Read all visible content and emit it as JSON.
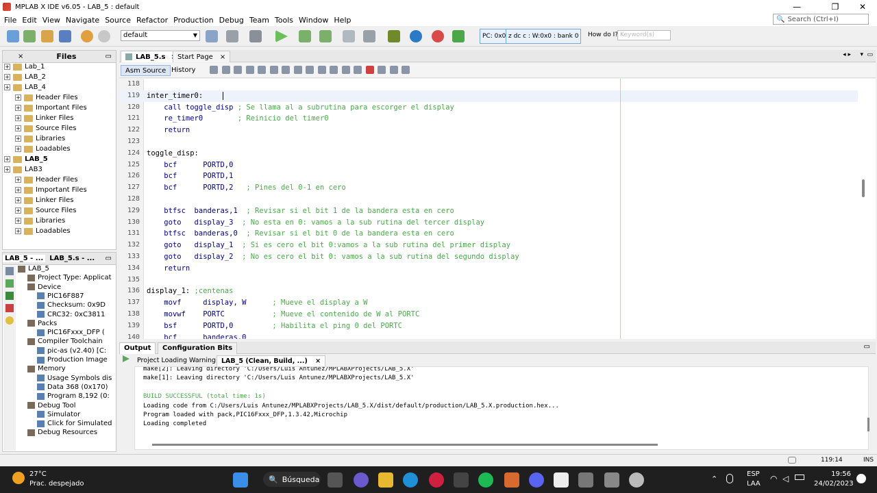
{
  "window": {
    "title": "MPLAB X IDE v6.05 - LAB_5 : default",
    "min": "—",
    "max": "❐",
    "close": "✕"
  },
  "menu": [
    "File",
    "Edit",
    "View",
    "Navigate",
    "Source",
    "Refactor",
    "Production",
    "Debug",
    "Team",
    "Tools",
    "Window",
    "Help"
  ],
  "search": {
    "placeholder": "Search (Ctrl+I)"
  },
  "toolbar": {
    "config": "default",
    "pc": "PC: 0x0",
    "status": "z dc c  : W:0x0 : bank 0",
    "howdo": "How do I?",
    "keyword_placeholder": "Keyword(s)"
  },
  "files_panel": {
    "tab": "Files",
    "items": [
      {
        "label": "Lab_1",
        "level": 0,
        "bold": false
      },
      {
        "label": "LAB_2",
        "level": 0,
        "bold": false
      },
      {
        "label": "LAB_4",
        "level": 0,
        "bold": false
      },
      {
        "label": "Header Files",
        "level": 1,
        "bold": false
      },
      {
        "label": "Important Files",
        "level": 1,
        "bold": false
      },
      {
        "label": "Linker Files",
        "level": 1,
        "bold": false
      },
      {
        "label": "Source Files",
        "level": 1,
        "bold": false
      },
      {
        "label": "Libraries",
        "level": 1,
        "bold": false
      },
      {
        "label": "Loadables",
        "level": 1,
        "bold": false
      },
      {
        "label": "LAB_5",
        "level": 0,
        "bold": true
      },
      {
        "label": "LAB3",
        "level": 0,
        "bold": false
      },
      {
        "label": "Header Files",
        "level": 1,
        "bold": false
      },
      {
        "label": "Important Files",
        "level": 1,
        "bold": false
      },
      {
        "label": "Linker Files",
        "level": 1,
        "bold": false
      },
      {
        "label": "Source Files",
        "level": 1,
        "bold": false
      },
      {
        "label": "Libraries",
        "level": 1,
        "bold": false
      },
      {
        "label": "Loadables",
        "level": 1,
        "bold": false
      }
    ]
  },
  "dashboard": {
    "tabs": [
      "LAB_5 - ...",
      "LAB_5.s - ..."
    ],
    "items": [
      {
        "label": "LAB_5",
        "level": 0
      },
      {
        "label": "Project Type: Applicat",
        "level": 1
      },
      {
        "label": "Device",
        "level": 1
      },
      {
        "label": "PIC16F887",
        "level": 2
      },
      {
        "label": "Checksum: 0x9D",
        "level": 2
      },
      {
        "label": "CRC32: 0xC3811",
        "level": 2
      },
      {
        "label": "Packs",
        "level": 1
      },
      {
        "label": "PIC16Fxxx_DFP (",
        "level": 2
      },
      {
        "label": "Compiler Toolchain",
        "level": 1
      },
      {
        "label": "pic-as (v2.40) [C:",
        "level": 2
      },
      {
        "label": "Production Image",
        "level": 2
      },
      {
        "label": "Memory",
        "level": 1
      },
      {
        "label": "Usage Symbols dis",
        "level": 2
      },
      {
        "label": "Data 368 (0x170)",
        "level": 2
      },
      {
        "label": "Program 8,192 (0:",
        "level": 2
      },
      {
        "label": "Debug Tool",
        "level": 1
      },
      {
        "label": "Simulator",
        "level": 2
      },
      {
        "label": "Click for Simulated",
        "level": 2
      },
      {
        "label": "Debug Resources",
        "level": 1
      }
    ]
  },
  "editor": {
    "tabs": [
      "LAB_5.s",
      "Start Page"
    ],
    "subtabs": [
      "Asm Source",
      "History"
    ],
    "lines": [
      {
        "n": "118",
        "label": "",
        "ins": "",
        "arg": "",
        "cmt": ""
      },
      {
        "n": "119",
        "label": "inter_timer0:",
        "ins": "",
        "arg": "",
        "cmt": ""
      },
      {
        "n": "120",
        "label": "",
        "ins": "call",
        "arg": " toggle_disp",
        "cmt": " ; Se llama al a subrutina para escorger el display"
      },
      {
        "n": "121",
        "label": "",
        "ins": "re_timer0",
        "arg": "",
        "cmt": "        ; Reinicio del timer0"
      },
      {
        "n": "122",
        "label": "",
        "ins": "return",
        "arg": "",
        "cmt": ""
      },
      {
        "n": "123",
        "label": "",
        "ins": "",
        "arg": "",
        "cmt": ""
      },
      {
        "n": "124",
        "label": "toggle_disp:",
        "ins": "",
        "arg": "",
        "cmt": ""
      },
      {
        "n": "125",
        "label": "",
        "ins": "bcf",
        "arg": "      PORTD,0",
        "cmt": ""
      },
      {
        "n": "126",
        "label": "",
        "ins": "bcf",
        "arg": "      PORTD,1",
        "cmt": ""
      },
      {
        "n": "127",
        "label": "",
        "ins": "bcf",
        "arg": "      PORTD,2",
        "cmt": "   ; Pines del 0-1 en cero"
      },
      {
        "n": "128",
        "label": "",
        "ins": "",
        "arg": "",
        "cmt": ""
      },
      {
        "n": "129",
        "label": "",
        "ins": "btfsc",
        "arg": "  banderas,1",
        "cmt": "  ; Revisar si el bit 1 de la bandera esta en cero"
      },
      {
        "n": "130",
        "label": "",
        "ins": "goto",
        "arg": "   display_3",
        "cmt": "  ; No esta en 0: vamos a la sub rutina del tercer display"
      },
      {
        "n": "131",
        "label": "",
        "ins": "btfsc",
        "arg": "  banderas,0",
        "cmt": "  ; Revisar si el bit 0 de la bandera esta en cero"
      },
      {
        "n": "132",
        "label": "",
        "ins": "goto",
        "arg": "   display_1",
        "cmt": "  ; Si es cero el bit 0:vamos a la sub rutina del primer display"
      },
      {
        "n": "133",
        "label": "",
        "ins": "goto",
        "arg": "   display_2",
        "cmt": "  ; No es cero el bit 0: vamos a la sub rutina del segundo display"
      },
      {
        "n": "134",
        "label": "",
        "ins": "return",
        "arg": "",
        "cmt": ""
      },
      {
        "n": "135",
        "label": "",
        "ins": "",
        "arg": "",
        "cmt": ""
      },
      {
        "n": "136",
        "label": "display_1:",
        "ins": "",
        "arg": "",
        "cmt": " ;centenas"
      },
      {
        "n": "137",
        "label": "",
        "ins": "movf",
        "arg": "     display, W",
        "cmt": "      ; Mueve el display a W"
      },
      {
        "n": "138",
        "label": "",
        "ins": "movwf",
        "arg": "    PORTC",
        "cmt": "           ; Mueve el contenido de W al PORTC"
      },
      {
        "n": "139",
        "label": "",
        "ins": "bsf",
        "arg": "      PORTD,0",
        "cmt": "         ; Habilita el ping 0 del PORTC"
      },
      {
        "n": "140",
        "label": "",
        "ins": "bcf",
        "arg": "      banderas,0",
        "cmt": ""
      }
    ]
  },
  "output": {
    "tabs": [
      "Output",
      "Configuration Bits"
    ],
    "subtabs": [
      "Project Loading Warning",
      "LAB_5 (Clean, Build, ...)"
    ],
    "lines": [
      {
        "t": "make[2]: Leaving directory 'C:/Users/Luis Antunez/MPLABXProjects/LAB_5.X'",
        "g": false
      },
      {
        "t": "make[1]: Leaving directory 'C:/Users/Luis Antunez/MPLABXProjects/LAB_5.X'",
        "g": false
      },
      {
        "t": "",
        "g": false
      },
      {
        "t": "BUILD SUCCESSFUL (total time: 1s)",
        "g": true
      },
      {
        "t": "Loading code from C:/Users/Luis Antunez/MPLABXProjects/LAB_5.X/dist/default/production/LAB_5.X.production.hex...",
        "g": false
      },
      {
        "t": "Program loaded with pack,PIC16Fxxx_DFP,1.3.42,Microchip",
        "g": false
      },
      {
        "t": "Loading completed",
        "g": false
      }
    ]
  },
  "status": {
    "position": "119:14",
    "mode": "INS"
  },
  "taskbar": {
    "temp": "27°C",
    "weather": "Prac. despejado",
    "search": "Búsqueda",
    "lang1": "ESP",
    "lang2": "LAA",
    "time": "19:56",
    "date": "24/02/2023"
  }
}
